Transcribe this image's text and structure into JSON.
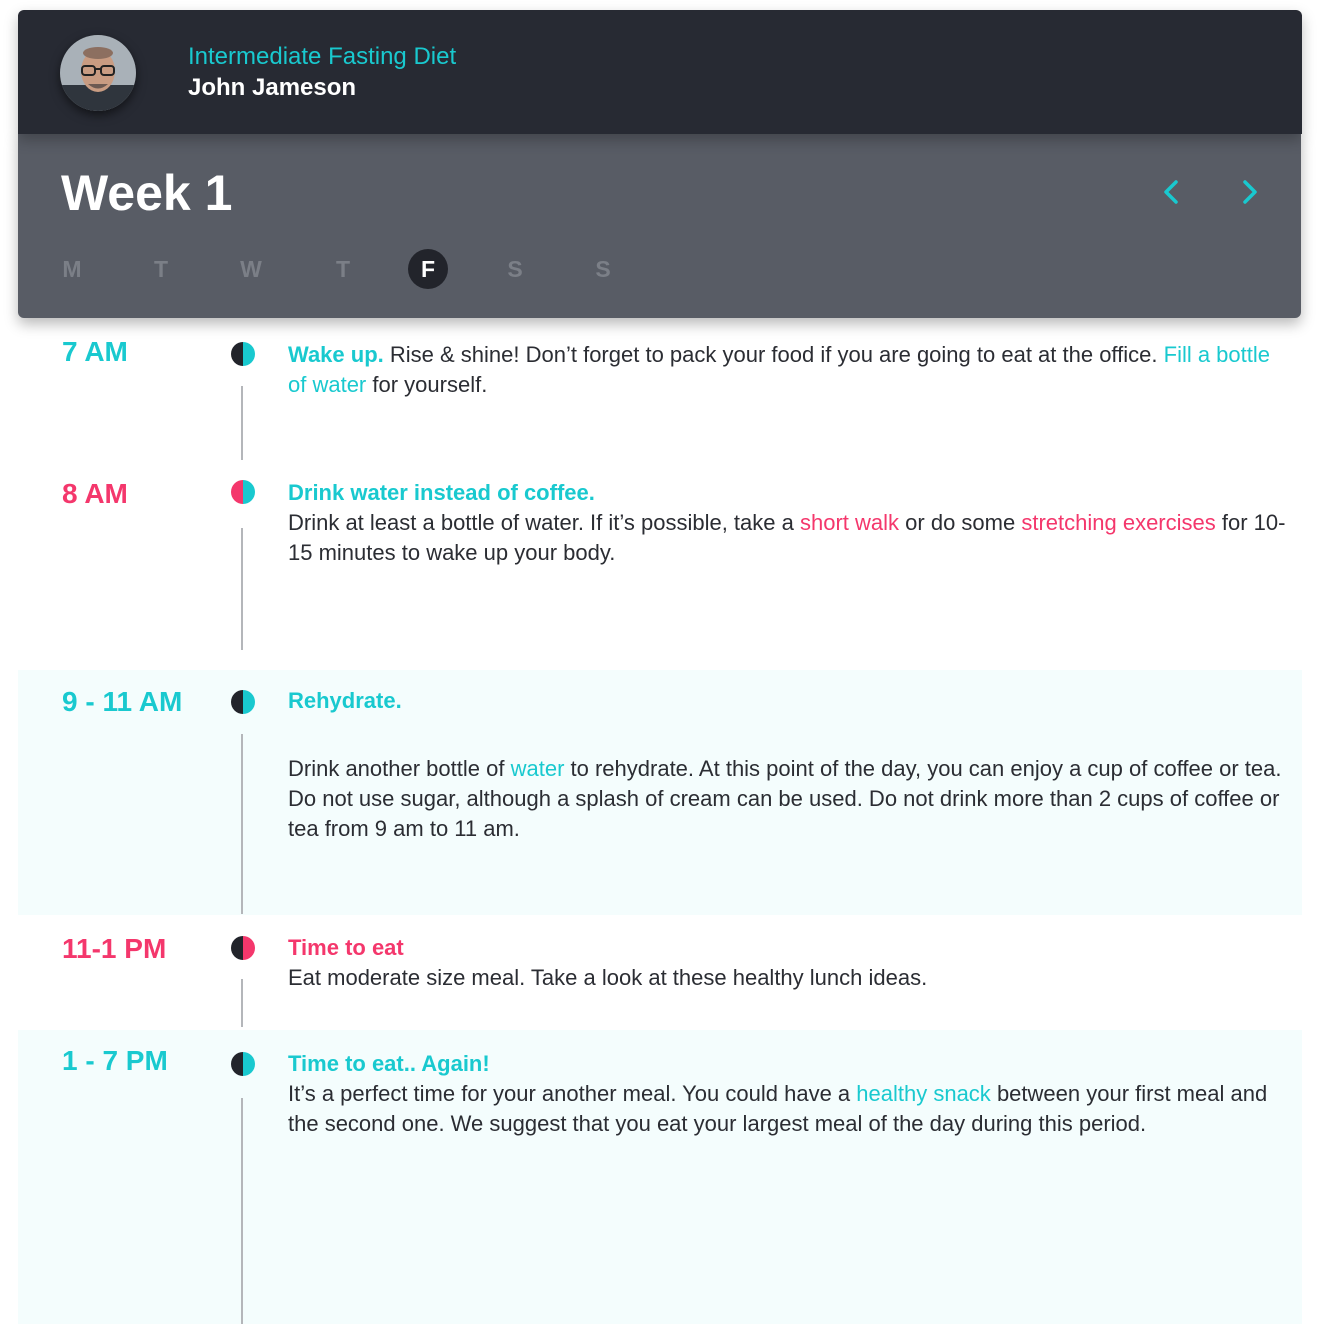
{
  "colors": {
    "accent_teal": "#19c9cf",
    "accent_pink": "#f4376c",
    "header_bg": "#272a33",
    "weekbar_bg": "#585c65",
    "tint_bg": "#f4fdfd"
  },
  "header": {
    "program_title": "Intermediate Fasting Diet",
    "user_name": "John Jameson",
    "avatar_icon": "user-avatar"
  },
  "week": {
    "title": "Week 1",
    "prev_icon": "chevron-left-icon",
    "next_icon": "chevron-right-icon",
    "days": [
      "M",
      "T",
      "W",
      "T",
      "F",
      "S",
      "S"
    ],
    "active_day": "F"
  },
  "schedule": [
    {
      "time": "7 AM",
      "heading": "Wake up.",
      "text_1": "Rise & shine! Don’t forget to pack your food if you are going to eat at the office.",
      "link_1": "Fill a bottle of water",
      "text_2": "for yourself."
    },
    {
      "time": "8 AM",
      "heading": "Drink water instead of coffee.",
      "text_1": "Drink at least a bottle of water. If it’s possible, take a",
      "link_1": "short walk",
      "text_2": "or do some",
      "link_2": "stretching exercises",
      "text_3": "for 10-15 minutes to wake up your body."
    },
    {
      "time": "9 - 11 AM",
      "heading": "Rehydrate.",
      "text_1": "Drink another bottle of",
      "link_1": "water",
      "text_2": "to rehydrate. At this point of the day, you can enjoy a cup of coffee or tea. Do not use sugar, although a splash of cream can be used. Do not drink more than 2 cups of coffee or tea from 9 am to 11 am."
    },
    {
      "time": "11-1 PM",
      "heading": "Time to eat",
      "text_1": "Eat moderate size meal. Take a look at these healthy lunch ideas."
    },
    {
      "time": "1 - 7 PM",
      "heading": "Time to eat.. Again!",
      "text_1": "It’s a perfect time for your another meal. You could have a",
      "link_1": "healthy snack",
      "text_2": "between your first meal and the second one. We suggest that you eat your largest meal of the day during this period."
    }
  ]
}
